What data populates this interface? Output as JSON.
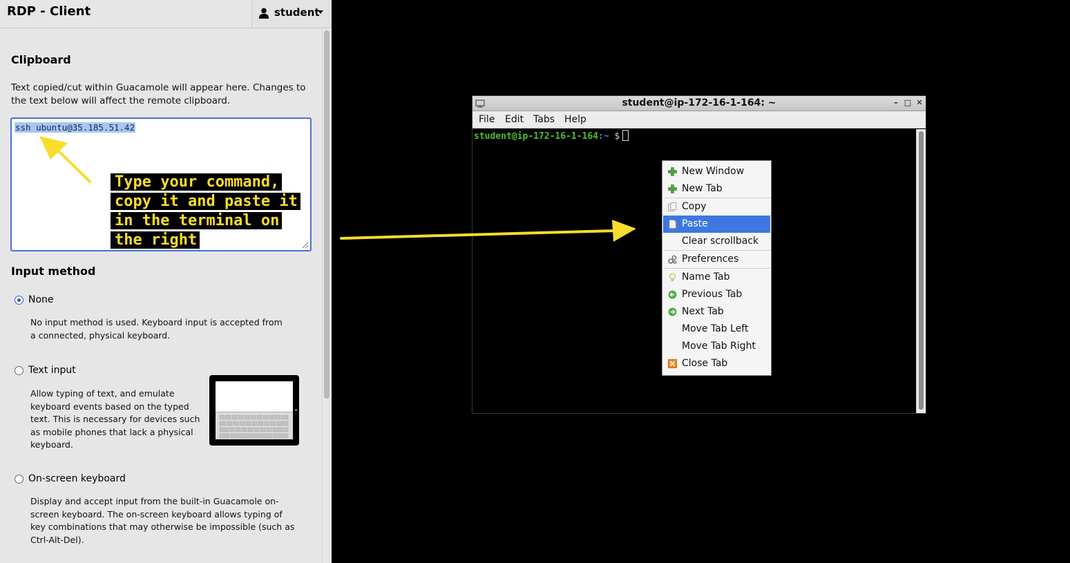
{
  "app": {
    "title": "RDP - Client",
    "user": "student"
  },
  "clipboard": {
    "title": "Clipboard",
    "description": "Text copied/cut within Guacamole will appear here. Changes to the text below will affect the remote clipboard.",
    "content": "ssh ubuntu@35.185.51.42"
  },
  "input_method": {
    "title": "Input method",
    "options": [
      {
        "label": "None",
        "selected": true,
        "description": "No input method is used. Keyboard input is accepted from a connected, physical keyboard."
      },
      {
        "label": "Text input",
        "selected": false,
        "description": "Allow typing of text, and emulate keyboard events based on the typed text. This is necessary for devices such as mobile phones that lack a physical keyboard."
      },
      {
        "label": "On-screen keyboard",
        "selected": false,
        "description": "Display and accept input from the built-in Guacamole on-screen keyboard. The on-screen keyboard allows typing of key combinations that may otherwise be impossible (such as Ctrl-Alt-Del)."
      }
    ]
  },
  "annotation": {
    "lines": [
      "Type your command,",
      "copy it and paste it",
      "in the terminal on",
      "the right"
    ],
    "color": "#f7dd2c"
  },
  "terminal": {
    "title": "student@ip-172-16-1-164: ~",
    "window_buttons": [
      "minimize-icon",
      "maximize-icon",
      "close-icon"
    ],
    "menus": [
      "File",
      "Edit",
      "Tabs",
      "Help"
    ],
    "prompt_user": "student@ip-172-16-1-164",
    "prompt_sep": ":~",
    "prompt_dollar": "$"
  },
  "context_menu": {
    "items": [
      {
        "label": "New Window",
        "icon": "plus-icon"
      },
      {
        "label": "New Tab",
        "icon": "plus-icon"
      },
      {
        "label": "Copy",
        "icon": "copy-icon"
      },
      {
        "label": "Paste",
        "icon": "paste-icon",
        "highlighted": true
      },
      {
        "label": "Clear scrollback",
        "icon": ""
      },
      {
        "label": "Preferences",
        "icon": "preferences-icon"
      },
      {
        "label": "Name Tab",
        "icon": "lightbulb-icon"
      },
      {
        "label": "Previous Tab",
        "icon": "previous-icon"
      },
      {
        "label": "Next Tab",
        "icon": "next-icon"
      },
      {
        "label": "Move Tab Left",
        "icon": ""
      },
      {
        "label": "Move Tab Right",
        "icon": ""
      },
      {
        "label": "Close Tab",
        "icon": "close-tab-icon"
      }
    ],
    "highlight_color": "#3d78e0"
  }
}
